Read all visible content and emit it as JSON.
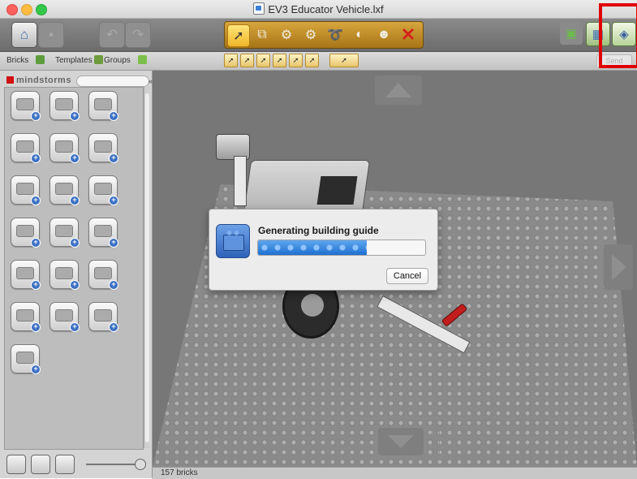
{
  "window": {
    "title": "EV3 Educator Vehicle.lxf"
  },
  "toolbar": {
    "icons": [
      "home-icon",
      "save-icon",
      "undo-icon",
      "redo-icon"
    ],
    "tools": [
      "select-tool",
      "clone-tool",
      "hinge-tool",
      "hinge-align-tool",
      "flex-tool",
      "paint-tool",
      "hide-tool",
      "delete-tool"
    ],
    "right": [
      "view-mode-icon",
      "build-mode-icon",
      "building-guide-mode-icon"
    ]
  },
  "subbar": {
    "tabs": [
      {
        "label": "Bricks"
      },
      {
        "label": "Templates"
      },
      {
        "label": "Groups"
      }
    ],
    "send_label": "Send"
  },
  "palette": {
    "brand": "mindstorms",
    "rows": 7
  },
  "dialog": {
    "title": "Generating building guide",
    "progress": 0.65,
    "cancel_label": "Cancel"
  },
  "status": {
    "brick_count": "157 bricks"
  },
  "colors": {
    "highlight": "#e00000",
    "progress": "#2f7fdb",
    "toolstrip": "#c08a26"
  }
}
